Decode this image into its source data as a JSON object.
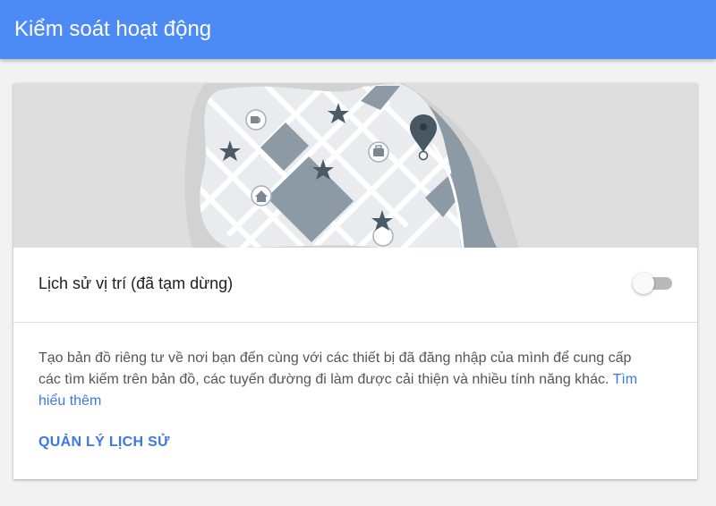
{
  "appbar": {
    "title": "Kiểm soát hoạt động"
  },
  "hero": {
    "illustration": "map-illustration",
    "icons": [
      "coffee-icon",
      "briefcase-icon",
      "home-icon",
      "star-icon",
      "location-pin-icon"
    ],
    "colors": {
      "background": "#dedede",
      "land": "#e9ebee",
      "roads": "#ffffff",
      "blocks": "#8c9aa5",
      "water": "#8c9aa5",
      "pin": "#475763"
    }
  },
  "setting": {
    "label": "Lịch sử vị trí (đã tạm dừng)",
    "toggle_on": false
  },
  "description": {
    "text": "Tạo bản đồ riêng tư về nơi bạn đến cùng với các thiết bị đã đăng nhập của mình để cung cấp các tìm kiếm trên bản đồ, các tuyến đường đi làm được cải thiện và nhiều tính năng khác. ",
    "link": "Tìm hiểu thêm"
  },
  "actions": {
    "manage_label": "QUẢN LÝ LỊCH SỬ"
  },
  "colors": {
    "appbar": "#4c8bf5",
    "accent": "#3b78e7",
    "page_bg": "#f2f2f2"
  }
}
